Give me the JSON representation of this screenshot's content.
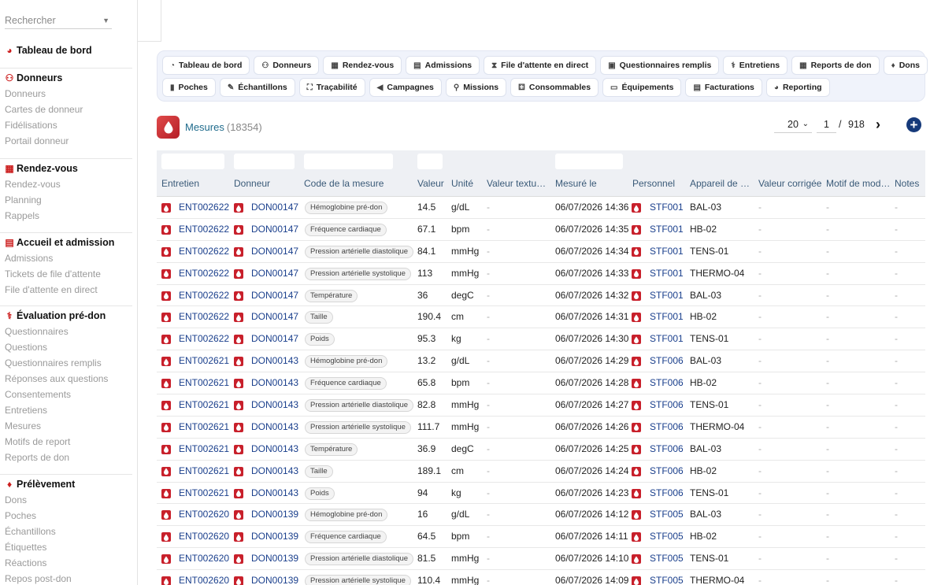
{
  "sidebar": {
    "search_placeholder": "Rechercher",
    "groups": [
      {
        "title": "Tableau de bord",
        "icon": "dashboard-icon",
        "items": []
      },
      {
        "title": "Donneurs",
        "icon": "user-plus-icon",
        "items": [
          "Donneurs",
          "Cartes de donneur",
          "Fidélisations",
          "Portail donneur"
        ]
      },
      {
        "title": "Rendez-vous",
        "icon": "calendar-icon",
        "items": [
          "Rendez-vous",
          "Planning",
          "Rappels"
        ]
      },
      {
        "title": "Accueil et admission",
        "icon": "clipboard-icon",
        "items": [
          "Admissions",
          "Tickets de file d'attente",
          "File d'attente en direct"
        ]
      },
      {
        "title": "Évaluation pré-don",
        "icon": "stethoscope-icon",
        "items": [
          "Questionnaires",
          "Questions",
          "Questionnaires remplis",
          "Réponses aux questions",
          "Consentements",
          "Entretiens",
          "Mesures",
          "Motifs de report",
          "Reports de don"
        ]
      },
      {
        "title": "Prélèvement",
        "icon": "drop-icon",
        "items": [
          "Dons",
          "Poches",
          "Échantillons",
          "Étiquettes",
          "Réactions",
          "Repos post-don"
        ]
      }
    ]
  },
  "nav": {
    "row1": [
      {
        "label": "Tableau de bord",
        "icon": "◔"
      },
      {
        "label": "Donneurs",
        "icon": "⚇"
      },
      {
        "label": "Rendez-vous",
        "icon": "▦"
      },
      {
        "label": "Admissions",
        "icon": "▤"
      },
      {
        "label": "File d'attente en direct",
        "icon": "⧗"
      },
      {
        "label": "Questionnaires remplis",
        "icon": "▣"
      },
      {
        "label": "Entretiens",
        "icon": "⚕"
      },
      {
        "label": "Reports de don",
        "icon": "▦"
      },
      {
        "label": "Dons",
        "icon": "♦"
      }
    ],
    "row2": [
      {
        "label": "Poches",
        "icon": "▮"
      },
      {
        "label": "Échantillons",
        "icon": "✎"
      },
      {
        "label": "Traçabilité",
        "icon": "⛶"
      },
      {
        "label": "Campagnes",
        "icon": "◀"
      },
      {
        "label": "Missions",
        "icon": "⚲"
      },
      {
        "label": "Consommables",
        "icon": "⚃"
      },
      {
        "label": "Équipements",
        "icon": "▭"
      },
      {
        "label": "Facturations",
        "icon": "▤"
      },
      {
        "label": "Reporting",
        "icon": "◕"
      }
    ]
  },
  "page": {
    "title": "Mesures",
    "count": "(18354)",
    "page_size": "20",
    "current_page": "1",
    "separator": "/",
    "total_pages": "918"
  },
  "table": {
    "columns": [
      "Entretien",
      "Donneur",
      "Code de la mesure",
      "Valeur",
      "Unité",
      "Valeur textu…",
      "Mesuré le",
      "Personnel",
      "Appareil de …",
      "Valeur corrigée",
      "Motif de mod…",
      "Notes"
    ],
    "rows": [
      [
        "ENT002622",
        "DON00147",
        "Hémoglobine pré-don",
        "14.5",
        "g/dL",
        "-",
        "06/07/2026 14:36",
        "STF001",
        "BAL-03",
        "-",
        "-",
        "-"
      ],
      [
        "ENT002622",
        "DON00147",
        "Fréquence cardiaque",
        "67.1",
        "bpm",
        "-",
        "06/07/2026 14:35",
        "STF001",
        "HB-02",
        "-",
        "-",
        "-"
      ],
      [
        "ENT002622",
        "DON00147",
        "Pression artérielle diastolique",
        "84.1",
        "mmHg",
        "-",
        "06/07/2026 14:34",
        "STF001",
        "TENS-01",
        "-",
        "-",
        "-"
      ],
      [
        "ENT002622",
        "DON00147",
        "Pression artérielle systolique",
        "113",
        "mmHg",
        "-",
        "06/07/2026 14:33",
        "STF001",
        "THERMO-04",
        "-",
        "-",
        "-"
      ],
      [
        "ENT002622",
        "DON00147",
        "Température",
        "36",
        "degC",
        "-",
        "06/07/2026 14:32",
        "STF001",
        "BAL-03",
        "-",
        "-",
        "-"
      ],
      [
        "ENT002622",
        "DON00147",
        "Taille",
        "190.4",
        "cm",
        "-",
        "06/07/2026 14:31",
        "STF001",
        "HB-02",
        "-",
        "-",
        "-"
      ],
      [
        "ENT002622",
        "DON00147",
        "Poids",
        "95.3",
        "kg",
        "-",
        "06/07/2026 14:30",
        "STF001",
        "TENS-01",
        "-",
        "-",
        "-"
      ],
      [
        "ENT002621",
        "DON00143",
        "Hémoglobine pré-don",
        "13.2",
        "g/dL",
        "-",
        "06/07/2026 14:29",
        "STF006",
        "BAL-03",
        "-",
        "-",
        "-"
      ],
      [
        "ENT002621",
        "DON00143",
        "Fréquence cardiaque",
        "65.8",
        "bpm",
        "-",
        "06/07/2026 14:28",
        "STF006",
        "HB-02",
        "-",
        "-",
        "-"
      ],
      [
        "ENT002621",
        "DON00143",
        "Pression artérielle diastolique",
        "82.8",
        "mmHg",
        "-",
        "06/07/2026 14:27",
        "STF006",
        "TENS-01",
        "-",
        "-",
        "-"
      ],
      [
        "ENT002621",
        "DON00143",
        "Pression artérielle systolique",
        "111.7",
        "mmHg",
        "-",
        "06/07/2026 14:26",
        "STF006",
        "THERMO-04",
        "-",
        "-",
        "-"
      ],
      [
        "ENT002621",
        "DON00143",
        "Température",
        "36.9",
        "degC",
        "-",
        "06/07/2026 14:25",
        "STF006",
        "BAL-03",
        "-",
        "-",
        "-"
      ],
      [
        "ENT002621",
        "DON00143",
        "Taille",
        "189.1",
        "cm",
        "-",
        "06/07/2026 14:24",
        "STF006",
        "HB-02",
        "-",
        "-",
        "-"
      ],
      [
        "ENT002621",
        "DON00143",
        "Poids",
        "94",
        "kg",
        "-",
        "06/07/2026 14:23",
        "STF006",
        "TENS-01",
        "-",
        "-",
        "-"
      ],
      [
        "ENT002620",
        "DON00139",
        "Hémoglobine pré-don",
        "16",
        "g/dL",
        "-",
        "06/07/2026 14:12",
        "STF005",
        "BAL-03",
        "-",
        "-",
        "-"
      ],
      [
        "ENT002620",
        "DON00139",
        "Fréquence cardiaque",
        "64.5",
        "bpm",
        "-",
        "06/07/2026 14:11",
        "STF005",
        "HB-02",
        "-",
        "-",
        "-"
      ],
      [
        "ENT002620",
        "DON00139",
        "Pression artérielle diastolique",
        "81.5",
        "mmHg",
        "-",
        "06/07/2026 14:10",
        "STF005",
        "TENS-01",
        "-",
        "-",
        "-"
      ],
      [
        "ENT002620",
        "DON00139",
        "Pression artérielle systolique",
        "110.4",
        "mmHg",
        "-",
        "06/07/2026 14:09",
        "STF005",
        "THERMO-04",
        "-",
        "-",
        "-"
      ]
    ]
  }
}
